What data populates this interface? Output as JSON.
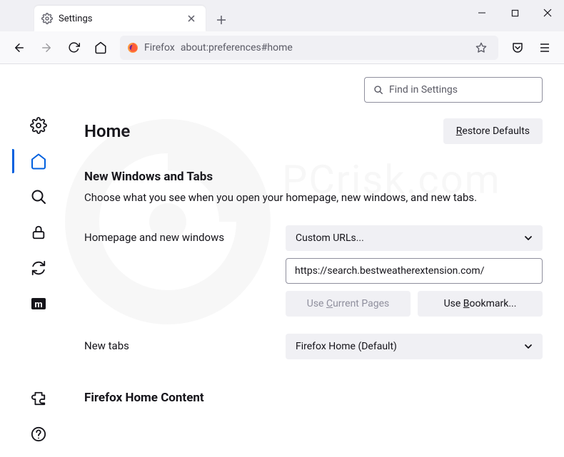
{
  "titlebar": {
    "tab_title": "Settings"
  },
  "toolbar": {
    "url_context": "Firefox",
    "url_path": "about:preferences#home"
  },
  "search": {
    "placeholder": "Find in Settings"
  },
  "header": {
    "title": "Home",
    "restore_button": "Restore Defaults"
  },
  "section1": {
    "heading": "New Windows and Tabs",
    "description": "Choose what you see when you open your homepage, new windows, and new tabs.",
    "homepage_label": "Homepage and new windows",
    "homepage_select": "Custom URLs...",
    "homepage_url": "https://search.bestweatherextension.com/",
    "use_current": "Use Current Pages",
    "use_bookmark": "Use Bookmark...",
    "newtabs_label": "New tabs",
    "newtabs_select": "Firefox Home (Default)"
  },
  "section2": {
    "heading": "Firefox Home Content"
  }
}
